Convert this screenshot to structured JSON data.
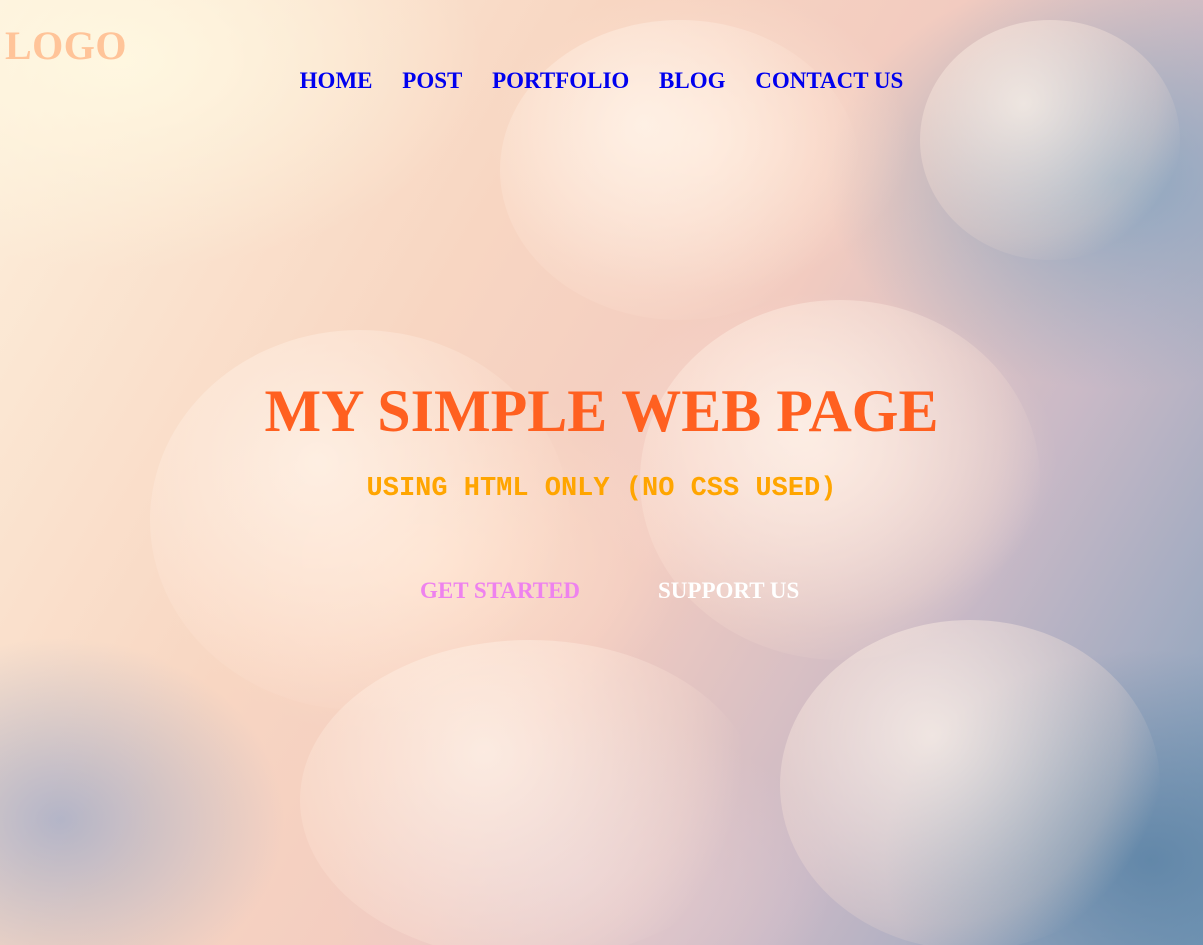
{
  "header": {
    "logo_text": "LOGO"
  },
  "nav": {
    "items": [
      {
        "label": "HOME"
      },
      {
        "label": "POST"
      },
      {
        "label": "PORTFOLIO"
      },
      {
        "label": "BLOG"
      },
      {
        "label": "CONTACT US"
      }
    ]
  },
  "hero": {
    "title": "MY SIMPLE WEB PAGE",
    "subtitle": "USING HTML ONLY (NO CSS USED)",
    "buttons": {
      "get_started": "GET STARTED",
      "support_us": "SUPPORT US"
    }
  },
  "colors": {
    "logo": "#ffc499",
    "nav_link": "#0000ee",
    "title": "#ff6020",
    "subtitle": "#ffa500",
    "get_started": "#ee82ee",
    "support_us": "#ffffff"
  }
}
